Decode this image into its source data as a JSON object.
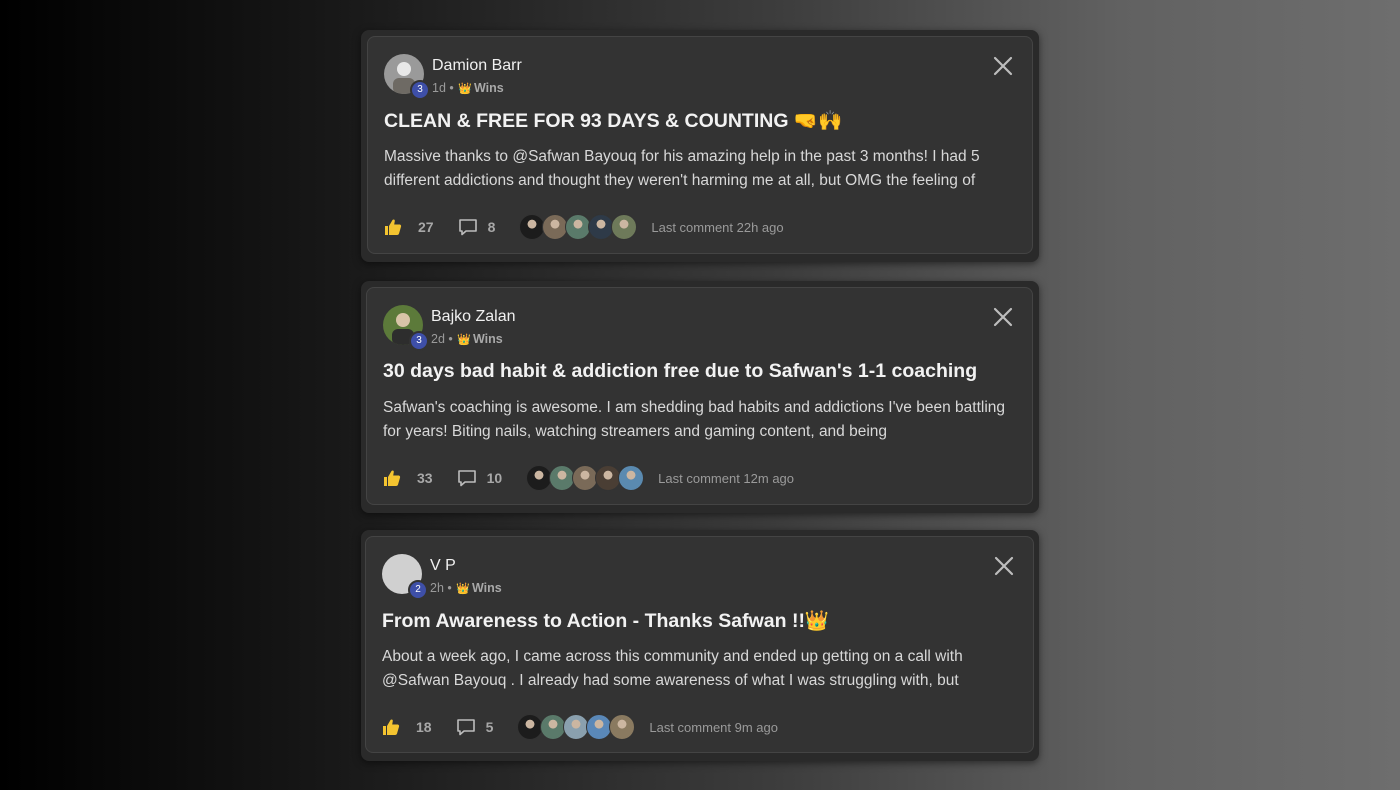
{
  "posts": [
    {
      "author": "Damion Barr",
      "level": "3",
      "time": "1d",
      "separator": "•",
      "category_icon": "👑",
      "category": "Wins",
      "title": "CLEAN & FREE FOR 93 DAYS & COUNTING 🤜🙌",
      "body": "Massive thanks to @Safwan Bayouq for his amazing help in the past 3 months! I had 5 different addictions and thought they weren't harming me at all, but OMG the feeling of",
      "likes": "27",
      "comments": "8",
      "last_comment": "Last comment 22h ago",
      "avatar_colors": [
        "#9a9a9a",
        "#e8e8e8",
        "#6e6a64"
      ]
    },
    {
      "author": "Bajko Zalan",
      "level": "3",
      "time": "2d",
      "separator": "•",
      "category_icon": "👑",
      "category": "Wins",
      "title": "30 days bad habit & addiction free due to Safwan's 1-1 coaching",
      "body": "Safwan's coaching is awesome. I am shedding bad habits and addictions I've been battling for years! Biting nails, watching streamers and gaming content, and being",
      "likes": "33",
      "comments": "10",
      "last_comment": "Last comment 12m ago",
      "avatar_colors": [
        "#5c7a3a",
        "#d8c4a8",
        "#2d2d2d"
      ]
    },
    {
      "author": "V P",
      "level": "2",
      "time": "2h",
      "separator": "•",
      "category_icon": "👑",
      "category": "Wins",
      "title": "From Awareness to Action - Thanks Safwan !!👑",
      "body": "About a week ago, I came across this community and ended up getting on a call with @Safwan Bayouq . I already had some awareness of what I was struggling with, but",
      "likes": "18",
      "comments": "5",
      "last_comment": "Last comment 9m ago",
      "avatar_colors": [
        "#d0d0d0",
        "#d0d0d0",
        "#d0d0d0"
      ]
    }
  ],
  "commenter_colors": [
    [
      "#1c1c1c",
      "#7a6a58",
      "#5a7a6a",
      "#2e3a48",
      "#6e7a5a"
    ],
    [
      "#1c1c1c",
      "#5a7a6a",
      "#7a6a58",
      "#4a3e34",
      "#5a8ab0"
    ],
    [
      "#1c1c1c",
      "#5a7a6a",
      "#8aa0ae",
      "#5a88b8",
      "#8a7a60"
    ]
  ],
  "accent_color": "#3e4fa8"
}
